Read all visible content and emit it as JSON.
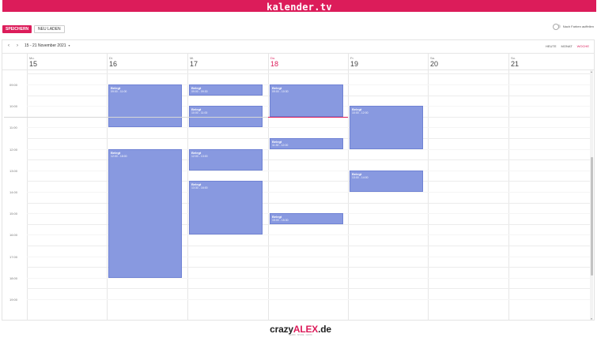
{
  "brand": {
    "title": "kalender.tv"
  },
  "actions": {
    "save_label": "SPEICHERN",
    "reload_label": "NEU LADEN"
  },
  "toggle": {
    "label": "Nach Farben auffeilen"
  },
  "toolbar": {
    "prev_icon": "chevron-left-icon",
    "next_icon": "chevron-right-icon",
    "date_range": "15 - 21 November 2021",
    "range_chevron": "▾"
  },
  "views": {
    "today_label": "HEUTE",
    "month_label": "MONAT",
    "week_label": "WOCHE",
    "active_view": "WOCHE"
  },
  "days": [
    {
      "name": "Mo.",
      "date": "15"
    },
    {
      "name": "Di.",
      "date": "16"
    },
    {
      "name": "Mi.",
      "date": "17"
    },
    {
      "name": "Do.",
      "date": "18"
    },
    {
      "name": "Fr.",
      "date": "19"
    },
    {
      "name": "Sa.",
      "date": "20"
    },
    {
      "name": "So.",
      "date": "21"
    }
  ],
  "today_day": "Do.",
  "time_labels": [
    "09:00",
    "10:00",
    "11:00",
    "12:00",
    "13:00",
    "14:00",
    "15:00",
    "16:00",
    "17:00",
    "18:00",
    "19:00"
  ],
  "events": [
    {
      "title": "Belegt",
      "time": "09:00 - 11:00",
      "day": 1,
      "start": "09:00",
      "end": "11:00"
    },
    {
      "title": "Belegt",
      "time": "12:00 - 18:00",
      "day": 1,
      "start": "12:00",
      "end": "18:00"
    },
    {
      "title": "Belegt",
      "time": "09:00 - 09:30",
      "day": 2,
      "start": "09:00",
      "end": "09:30"
    },
    {
      "title": "Belegt",
      "time": "10:00 - 11:00",
      "day": 2,
      "start": "10:00",
      "end": "11:00"
    },
    {
      "title": "Belegt",
      "time": "12:00 - 13:00",
      "day": 2,
      "start": "12:00",
      "end": "13:00"
    },
    {
      "title": "Belegt",
      "time": "13:30 - 16:00",
      "day": 2,
      "start": "13:30",
      "end": "16:00"
    },
    {
      "title": "Belegt",
      "time": "09:00 - 10:30",
      "day": 3,
      "start": "09:00",
      "end": "10:30"
    },
    {
      "title": "Belegt",
      "time": "11:30 - 12:00",
      "day": 3,
      "start": "11:30",
      "end": "12:00"
    },
    {
      "title": "Belegt",
      "time": "15:00 - 15:30",
      "day": 3,
      "start": "15:00",
      "end": "15:30"
    },
    {
      "title": "Belegt",
      "time": "10:00 - 12:00",
      "day": 4,
      "start": "10:00",
      "end": "12:00"
    },
    {
      "title": "Belegt",
      "time": "13:00 - 14:00",
      "day": 4,
      "start": "13:00",
      "end": "14:00"
    }
  ],
  "now_time": "10:30",
  "footer": {
    "logo_prefix": "crazy",
    "logo_accent": "ALEX",
    "logo_suffix": ".de",
    "tagline": "LEARN · SHARE · GROW"
  }
}
